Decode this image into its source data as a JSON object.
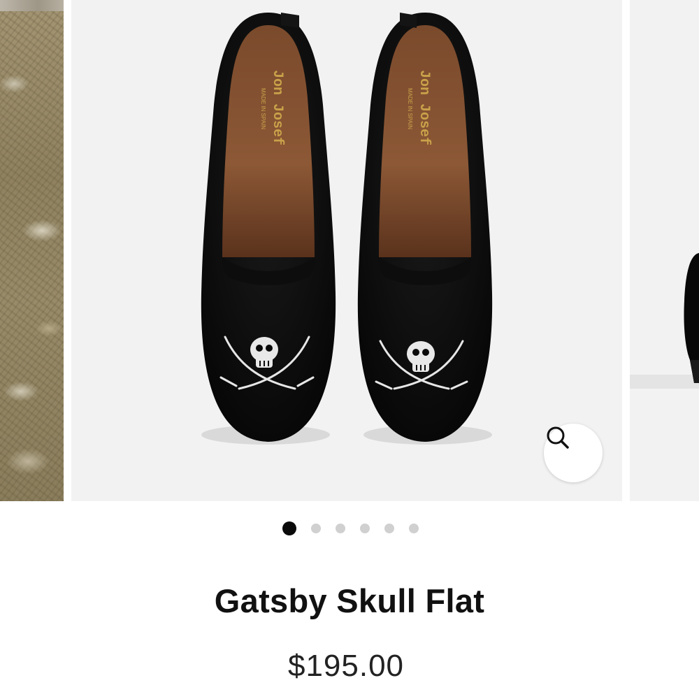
{
  "product": {
    "title": "Gatsby Skull Flat",
    "price": "$195.00"
  },
  "gallery": {
    "main_image": {
      "brand_left": "Jon Josef",
      "brand_right": "Jon Josef",
      "made_in_left": "MADE IN SPAIN",
      "made_in_right": "MADE IN SPAIN"
    },
    "dots_total": 6,
    "active_dot": 1,
    "zoom_icon": "search-icon"
  },
  "colors": {
    "background": "#ffffff",
    "image_background": "#f2f2f2",
    "dot_active": "#0a0a0a",
    "dot_inactive": "#d0d0d0",
    "brand_gold": "#c9a24a"
  }
}
